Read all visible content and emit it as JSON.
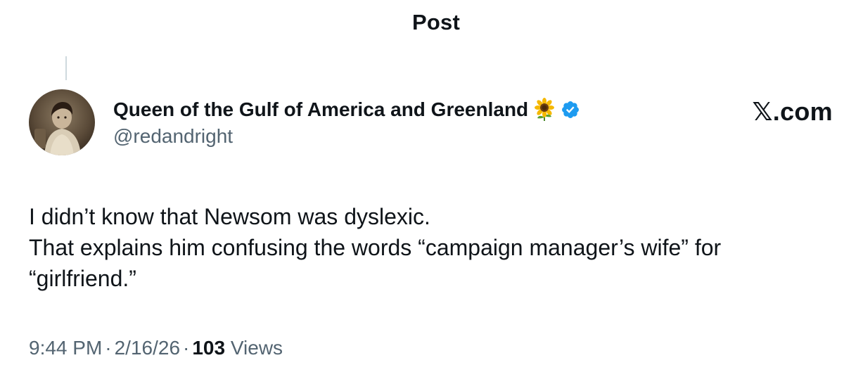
{
  "header": {
    "title": "Post"
  },
  "author": {
    "display_name": "Queen of the Gulf of America and Greenland",
    "handle": "@redandright",
    "name_emoji_icon": "sunflower-icon",
    "verified_icon": "verified-badge-icon"
  },
  "site": {
    "label": "𝕏.com"
  },
  "post": {
    "lines": [
      "I didn’t know that Newsom was dyslexic.",
      "That explains him confusing the words “campaign manager’s wife” for",
      "“girlfriend.”"
    ]
  },
  "meta": {
    "time": "9:44 PM",
    "separator": "·",
    "date": "2/16/26",
    "views_count": "103",
    "views_label": "Views"
  },
  "colors": {
    "text": "#0f1419",
    "secondary": "#536471",
    "verified": "#1d9bf0",
    "thread_line": "#cfd9de"
  }
}
